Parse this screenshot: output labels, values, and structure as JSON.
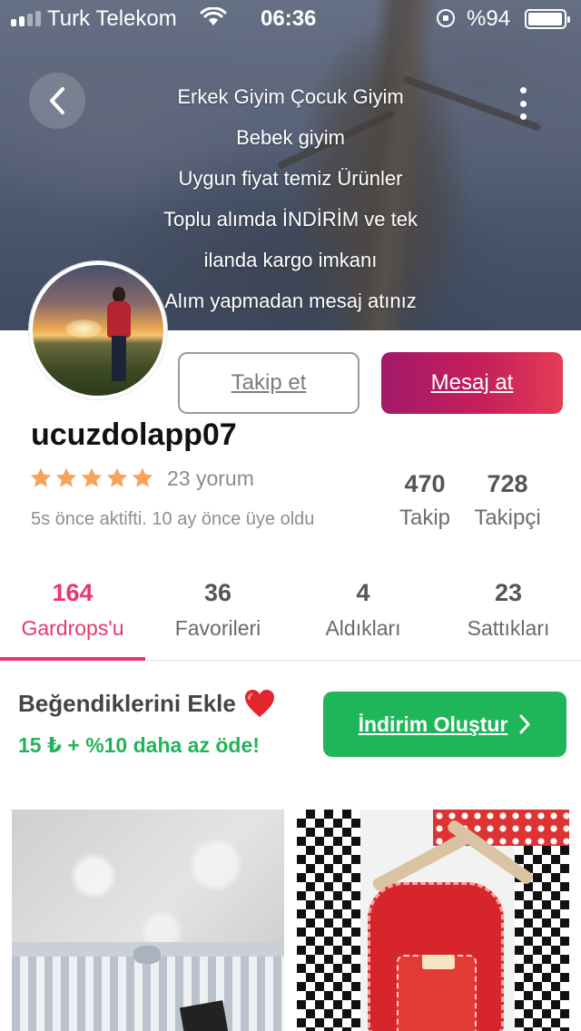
{
  "status_bar": {
    "carrier": "Turk Telekom",
    "time": "06:36",
    "battery": "%94",
    "battery_level": 0.94
  },
  "cover": {
    "bio_lines": [
      "Erkek Giyim Çocuk Giyim",
      "Bebek giyim",
      "Uygun fiyat  temiz Ürünler",
      "Toplu alımda İNDİRİM ve tek",
      "ilanda kargo imkanı",
      "Alım yapmadan mesaj atınız"
    ]
  },
  "actions": {
    "follow_label": "Takip et",
    "message_label": "Mesaj at"
  },
  "profile": {
    "username": "ucuzdolapp07",
    "rating": 5,
    "reviews": "23 yorum",
    "activity": "5s önce aktifti. 10 ay önce üye oldu",
    "following_count": "470",
    "following_label": "Takip",
    "followers_count": "728",
    "followers_label": "Takipçi"
  },
  "tabs": [
    {
      "count": "164",
      "label": "Gardrops'u",
      "active": true
    },
    {
      "count": "36",
      "label": "Favorileri",
      "active": false
    },
    {
      "count": "4",
      "label": "Aldıkları",
      "active": false
    },
    {
      "count": "23",
      "label": "Sattıkları",
      "active": false
    }
  ],
  "promo": {
    "title": "Beğendiklerini Ekle",
    "subtitle": "15 ₺ + %10 daha az öde!",
    "button_label": "İndirim Oluştur"
  },
  "colors": {
    "accent_pink": "#e8376b",
    "message_gradient_start": "#a3196a",
    "message_gradient_end": "#e33c54",
    "green": "#1fb65a",
    "star": "#f7a35c"
  }
}
